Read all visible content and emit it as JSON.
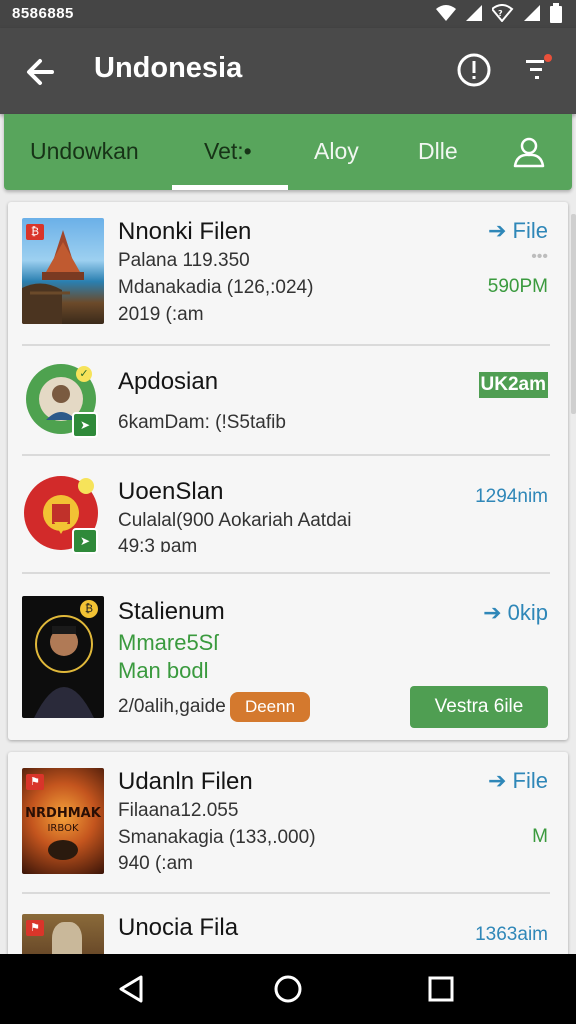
{
  "status_bar": {
    "time": "8586885",
    "icons": [
      "wifi-icon",
      "signal-icon",
      "wifi-calling-icon",
      "signal-icon",
      "battery-icon"
    ]
  },
  "app_bar": {
    "title": "Undonesia",
    "icons": [
      "back-arrow-icon",
      "info-icon",
      "filter-icon"
    ],
    "filter_dot_color": "#e9503a"
  },
  "tabs": [
    {
      "label": "Undowkan"
    },
    {
      "label": "Vet:•",
      "selected": true
    },
    {
      "label": "Aloy"
    },
    {
      "label": "Dlle"
    }
  ],
  "tab_profile_icon": "person-icon",
  "colors": {
    "accent_green": "#58a55c",
    "app_bar": "#4a4a4a",
    "link_blue": "#2f87b8",
    "badge_orange": "#d4792e"
  },
  "items": [
    {
      "title": "Nnonki Filen",
      "line1": "Palana 119.350",
      "line2": "Mdanakadia (126,:024)",
      "line3": "2019 (:am",
      "right_link": "File",
      "right_value": "590PM",
      "thumb_badge": "₿"
    },
    {
      "title": "Apdosian",
      "line1": "6kamDam: (!S5tafib",
      "tag": "UK2am",
      "thumb_badge": "✓"
    },
    {
      "title": "UoenSlan",
      "line1": "Culalal(900  Aokariah Aatdai",
      "line2": "49:3 ɒam",
      "right_value": "1294nim"
    },
    {
      "title": "Stalienum",
      "line1": "Mmare5Sſ",
      "line2": "Man bodl",
      "line3": "2/0alih,gaide",
      "badge": "Deenn",
      "right_link": "0kip",
      "action_button": "Vestra 6ile",
      "thumb_badge": "₿"
    },
    {
      "title": "Udanln Filen",
      "line1": "Filaana12.055",
      "line2": "Smanakagia (133,.000)",
      "line3": "940 (:am",
      "right_link": "File",
      "right_value": "M",
      "thumb_text_1": "NRDHMAK",
      "thumb_text_2": "IRBOK"
    },
    {
      "title": "Unocia Fila",
      "right_value": "1363aim"
    }
  ],
  "nav_bar": {
    "icons": [
      "back-triangle-icon",
      "home-circle-icon",
      "recents-square-icon"
    ]
  }
}
